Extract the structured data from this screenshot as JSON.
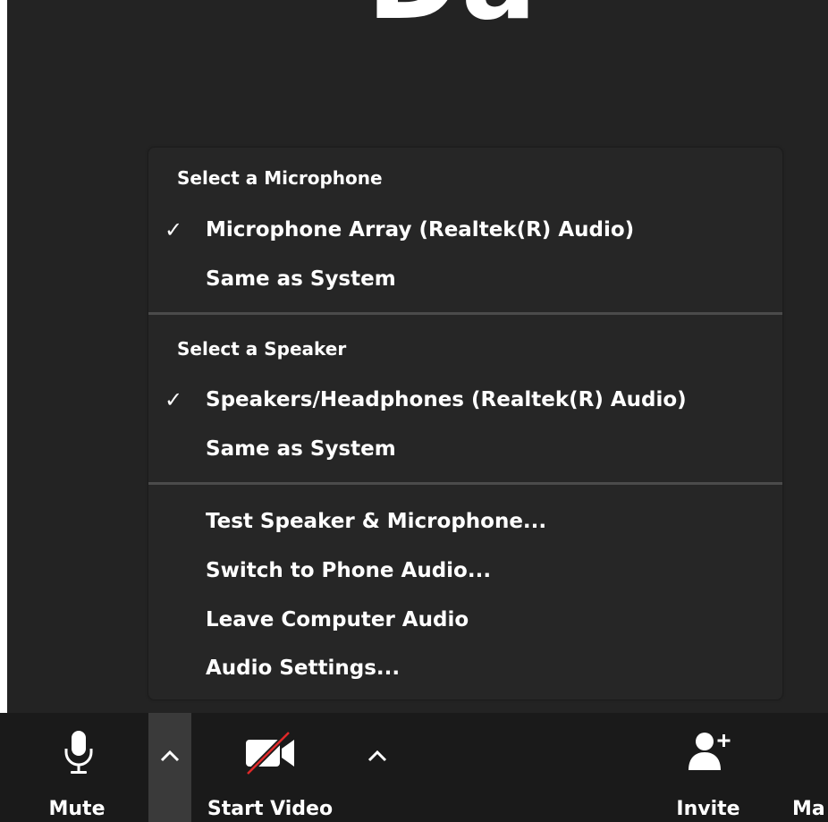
{
  "video": {
    "partial_text": "Da"
  },
  "audio_menu": {
    "microphone_header": "Select a Microphone",
    "microphones": [
      {
        "label": "Microphone Array (Realtek(R) Audio)",
        "checked": true
      },
      {
        "label": "Same as System",
        "checked": false
      }
    ],
    "speaker_header": "Select a Speaker",
    "speakers": [
      {
        "label": "Speakers/Headphones (Realtek(R) Audio)",
        "checked": true
      },
      {
        "label": "Same as System",
        "checked": false
      }
    ],
    "check_glyph": "✓",
    "actions": [
      {
        "label": "Test Speaker & Microphone..."
      },
      {
        "label": "Switch to Phone Audio..."
      },
      {
        "label": "Leave Computer Audio"
      },
      {
        "label": "Audio Settings..."
      }
    ]
  },
  "toolbar": {
    "mute_label": "Mute",
    "start_video_label": "Start Video",
    "invite_label": "Invite",
    "manage_label_partial": "Ma"
  },
  "colors": {
    "background": "#1a1a1a",
    "menu_background": "#262626",
    "divider": "#4b4b4b",
    "text": "#ffffff",
    "video_off_slash": "#e02828"
  },
  "icons": {
    "mute": "microphone-icon",
    "audio_caret": "chevron-up-icon",
    "video": "video-camera-off-icon",
    "video_caret": "chevron-up-icon",
    "invite": "add-person-icon",
    "check": "checkmark-icon"
  }
}
